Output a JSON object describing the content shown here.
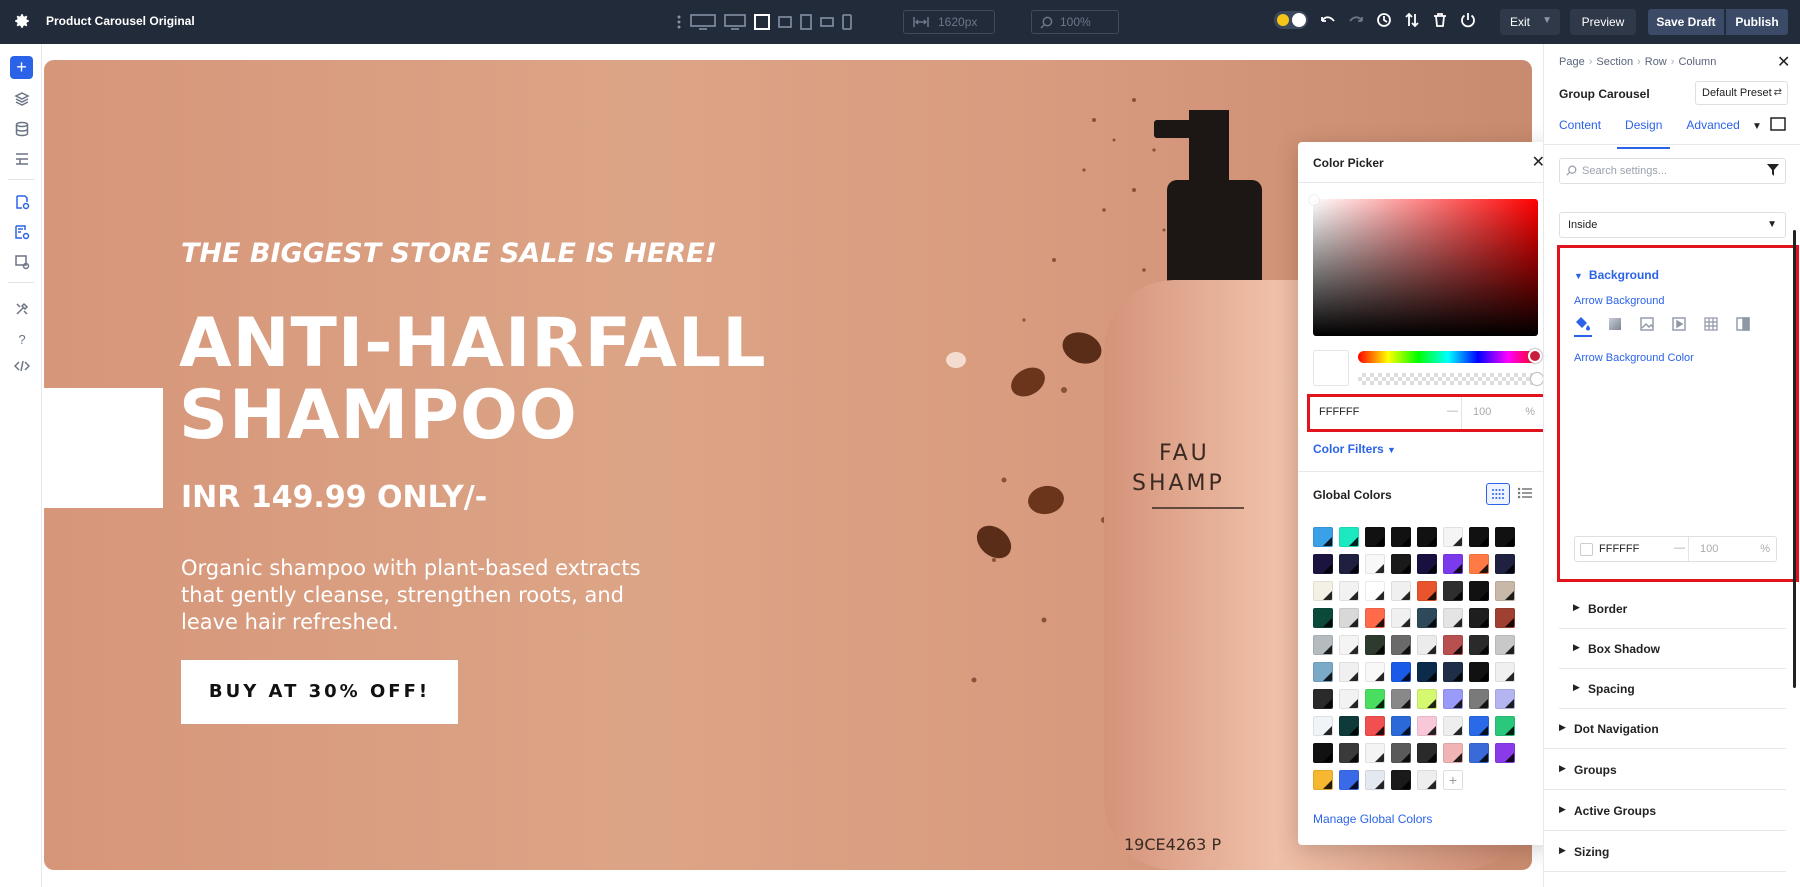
{
  "app": {
    "title": "Product Carousel Original",
    "width_value": "1620px",
    "zoom_value": "100%",
    "exit_label": "Exit",
    "preview_label": "Preview",
    "save_draft_label": "Save Draft",
    "publish_label": "Publish"
  },
  "hero": {
    "subtitle": "THE BIGGEST STORE SALE IS HERE!",
    "title_line1": "ANTI-HAIRFALL",
    "title_line2": "SHAMPOO",
    "price": "INR 149.99 ONLY/-",
    "description": "Organic shampoo with plant-based extracts that gently cleanse, strengthen roots, and leave hair refreshed.",
    "cta": "BUY AT 30% OFF!",
    "bottle_text_line1": "FAU",
    "bottle_text_line2": "SHAMP",
    "bottle_code": "19CE4263 P"
  },
  "color_picker": {
    "title": "Color Picker",
    "hex": "FFFFFF",
    "alpha_dash": "—",
    "alpha": "100",
    "percent": "%",
    "color_filters": "Color Filters",
    "global_colors_title": "Global Colors",
    "manage_link": "Manage Global Colors",
    "swatches": [
      "#3aa0e8",
      "#1de9c0",
      "#111111",
      "#111111",
      "#111111",
      "#f5f5f5",
      "#111111",
      "#111111",
      "#1c1440",
      "#1f2040",
      "#f8f8f8",
      "#1a1a1a",
      "#1a1040",
      "#7c3aed",
      "#ff7a45",
      "#1e2240",
      "#f4f0e6",
      "#f2f2f2",
      "#ffffff",
      "#f0f0f0",
      "#e8542c",
      "#2e2e2e",
      "#111111",
      "#c8b8a8",
      "#0b4a3a",
      "#d8d8d8",
      "#ff6a4a",
      "#f0f0f0",
      "#2e4a5a",
      "#e4e4e4",
      "#1e1e1e",
      "#a04030",
      "#b4bcc0",
      "#f4f4f4",
      "#2e3a2e",
      "#6a6a6a",
      "#ececec",
      "#b85050",
      "#2a2a2a",
      "#c8c8c8",
      "#7aaac8",
      "#f0f0f0",
      "#f8f8f8",
      "#1a5ae8",
      "#0c2a4a",
      "#1e2e48",
      "#111111",
      "#f0f0f0",
      "#2a2a2a",
      "#f2f2f2",
      "#4ade60",
      "#888888",
      "#d4f870",
      "#9a9af8",
      "#7a7a7a",
      "#b4b4f0",
      "#f0f4f8",
      "#0e3a3a",
      "#f05050",
      "#2a6ad8",
      "#f8c8d8",
      "#eeeeee",
      "#2a6ae8",
      "#2ac87a",
      "#111111",
      "#3a3a3a",
      "#f4f4f4",
      "#5a5a5a",
      "#2a2a2a",
      "#f0b4b4",
      "#3a6ad8",
      "#8a3ae8",
      "#f5b830",
      "#3a6ae8",
      "#e4e8f0",
      "#1a1a1a",
      "#eeeeee"
    ]
  },
  "panel": {
    "breadcrumb": [
      "Page",
      "Section",
      "Row",
      "Column"
    ],
    "module_name": "Group Carousel",
    "preset": "Default Preset",
    "tabs": [
      "Content",
      "Design",
      "Advanced"
    ],
    "search_placeholder": "Search settings...",
    "position_select": "Inside",
    "background_heading": "Background",
    "arrow_background_label": "Arrow Background",
    "arrow_background_color_label": "Arrow Background Color",
    "bg_hex": "FFFFFF",
    "bg_alpha_dash": "—",
    "bg_alpha": "100",
    "bg_percent": "%",
    "sub_sections": [
      "Border",
      "Box Shadow",
      "Spacing"
    ],
    "sections": [
      "Dot Navigation",
      "Groups",
      "Active Groups",
      "Sizing"
    ]
  }
}
